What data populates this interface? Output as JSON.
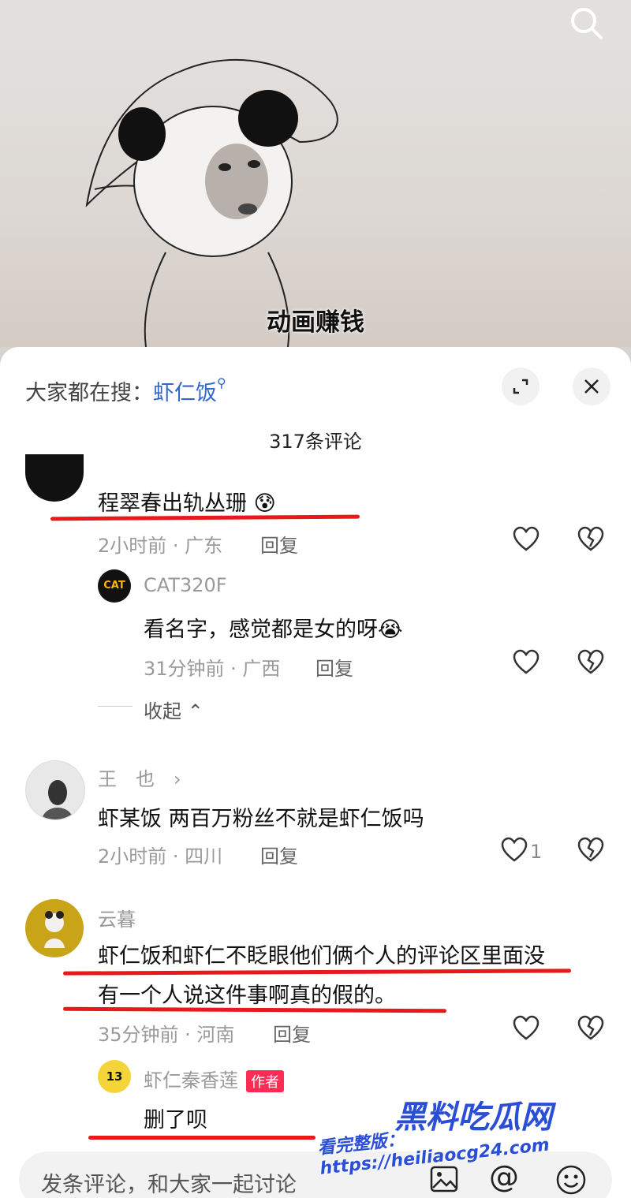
{
  "video": {
    "caption": "动画赚钱"
  },
  "header": {
    "search_prefix": "大家都在搜：",
    "search_keyword": "虾仁饭",
    "comment_count": "317条评论"
  },
  "comments": [
    {
      "text": "程翠春出轨丛珊",
      "meta": "2小时前 · 广东",
      "reply": "回复"
    },
    {
      "user": "CAT320F",
      "text": "看名字，感觉都是女的呀",
      "meta": "31分钟前 · 广西",
      "reply": "回复"
    },
    {
      "collapse": "收起"
    },
    {
      "user": "王　也",
      "text": "虾某饭 两百万粉丝不就是虾仁饭吗",
      "meta": "2小时前 · 四川",
      "reply": "回复",
      "likes": "1"
    },
    {
      "user": "云暮",
      "text": "虾仁饭和虾仁不眨眼他们俩个人的评论区里面没",
      "text2": "有一个人说这件事啊真的假的。",
      "meta": "35分钟前 · 河南",
      "reply": "回复"
    },
    {
      "user": "虾仁秦香莲",
      "badge": "作者",
      "text": "删了呗"
    }
  ],
  "input": {
    "placeholder": "发条评论，和大家一起讨论"
  },
  "watermark": {
    "title": "黑料吃瓜网",
    "url": "看完整版：https://heiliaocg24.com"
  },
  "colors": {
    "accent_red": "#e8191b",
    "author_badge": "#fe2c55",
    "keyword_blue": "#3366cc"
  },
  "icons": [
    "search-icon",
    "expand-icon",
    "close-icon",
    "heart-icon",
    "broken-heart-icon",
    "chevron-up-icon",
    "image-icon",
    "at-icon",
    "emoji-icon"
  ]
}
